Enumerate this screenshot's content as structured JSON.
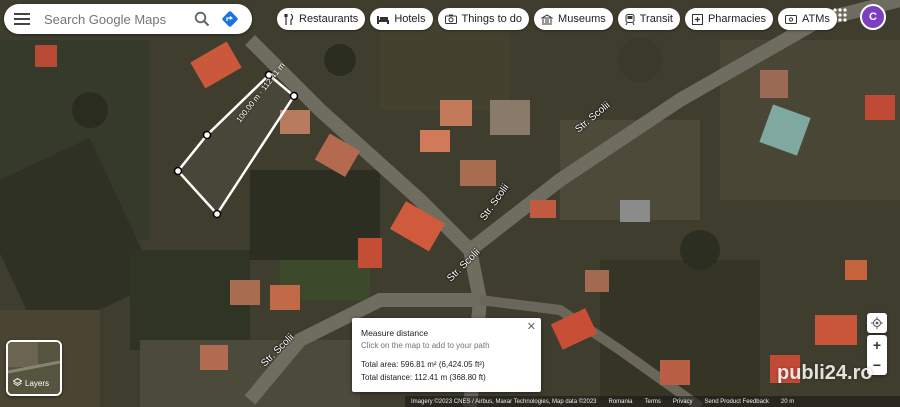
{
  "search": {
    "placeholder": "Search Google Maps"
  },
  "chips": [
    {
      "label": "Restaurants",
      "icon": "fork-knife-icon"
    },
    {
      "label": "Hotels",
      "icon": "bed-icon"
    },
    {
      "label": "Things to do",
      "icon": "camera-icon"
    },
    {
      "label": "Museums",
      "icon": "museum-icon"
    },
    {
      "label": "Transit",
      "icon": "train-icon"
    },
    {
      "label": "Pharmacies",
      "icon": "pharmacy-icon"
    },
    {
      "label": "ATMs",
      "icon": "atm-icon"
    }
  ],
  "account": {
    "initial": "C",
    "color": "#7b3fbf"
  },
  "streets": [
    "Str. Scolii",
    "Str. Scolii",
    "Str. Scolii",
    "Str. Scolii"
  ],
  "measure_label": "100.00 m · 112.41 m",
  "measure": {
    "title": "Measure distance",
    "hint": "Click on the map to add to your path",
    "area": "Total area: 596.81 m² (6,424.05 ft²)",
    "distance": "Total distance: 112.41 m (368.80 ft)"
  },
  "layers_label": "Layers",
  "footer": {
    "imagery": "Imagery ©2023 CNES / Airbus, Maxar Technologies, Map data ©2023",
    "links": [
      "Romania",
      "Terms",
      "Privacy",
      "Send Product Feedback"
    ],
    "scale": "20 m"
  },
  "watermark": "publi24.ro"
}
